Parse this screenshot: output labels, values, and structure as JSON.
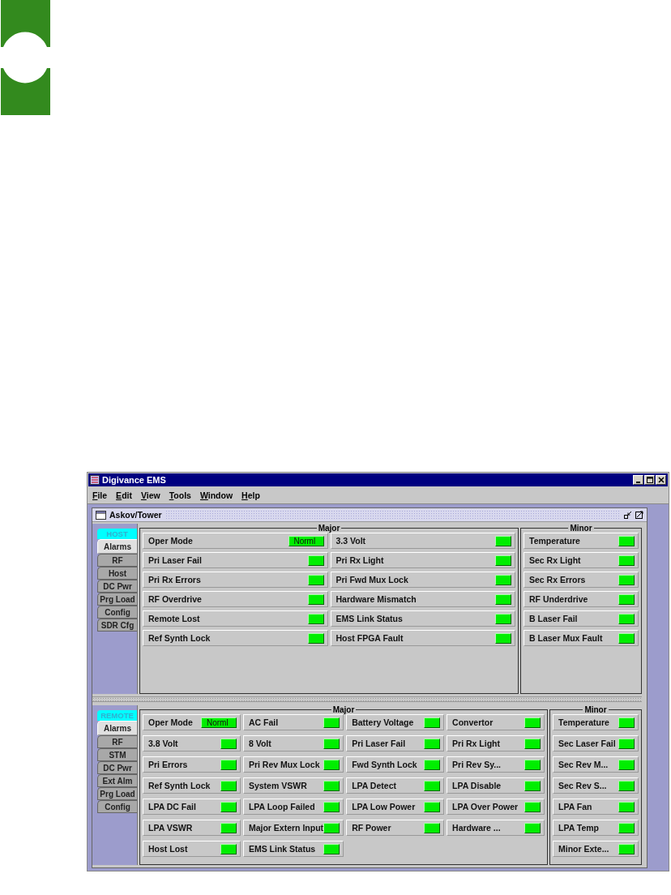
{
  "window": {
    "title": "Digivance EMS"
  },
  "menu": [
    {
      "label": "File"
    },
    {
      "label": "Edit"
    },
    {
      "label": "View"
    },
    {
      "label": "Tools"
    },
    {
      "label": "Window"
    },
    {
      "label": "Help"
    }
  ],
  "frame": {
    "title": "Askov/Tower"
  },
  "panels": [
    {
      "header": "HOST",
      "tabs": [
        {
          "label": "Alarms",
          "selected": true
        },
        {
          "label": "RF",
          "selected": false
        },
        {
          "label": "Host",
          "selected": false
        },
        {
          "label": "DC Pwr",
          "selected": false
        },
        {
          "label": "Prg Load",
          "selected": false
        },
        {
          "label": "Config",
          "selected": false
        },
        {
          "label": "SDR Cfg",
          "selected": false
        }
      ],
      "major": {
        "title": "Major",
        "rows": [
          [
            {
              "label": "Oper Mode",
              "color": "#00ee00",
              "value": "Norml"
            },
            {
              "label": "3.3 Volt",
              "color": "#00ee00"
            }
          ],
          [
            {
              "label": "Pri Laser Fail",
              "color": "#00ee00"
            },
            {
              "label": "Pri Rx Light",
              "color": "#00ee00"
            }
          ],
          [
            {
              "label": "Pri Rx Errors",
              "color": "#00ee00"
            },
            {
              "label": "Pri Fwd Mux Lock",
              "color": "#00ee00"
            }
          ],
          [
            {
              "label": "RF Overdrive",
              "color": "#00ee00"
            },
            {
              "label": "Hardware Mismatch",
              "color": "#00ee00"
            }
          ],
          [
            {
              "label": "Remote Lost",
              "color": "#00ee00"
            },
            {
              "label": "EMS Link Status",
              "color": "#00ee00"
            }
          ],
          [
            {
              "label": "Ref Synth Lock",
              "color": "#00ee00"
            },
            {
              "label": "Host FPGA Fault",
              "color": "#00ee00"
            }
          ]
        ]
      },
      "minor": {
        "title": "Minor",
        "items": [
          {
            "label": "Temperature",
            "color": "#00ee00"
          },
          {
            "label": "Sec Rx Light",
            "color": "#00ee00"
          },
          {
            "label": "Sec Rx Errors",
            "color": "#00ee00"
          },
          {
            "label": "RF Underdrive",
            "color": "#00ee00"
          },
          {
            "label": "B Laser Fail",
            "color": "#00ee00"
          },
          {
            "label": "B Laser Mux Fault",
            "color": "#00ee00"
          }
        ]
      }
    },
    {
      "header": "REMOTE",
      "tabs": [
        {
          "label": "Alarms",
          "selected": true
        },
        {
          "label": "RF",
          "selected": false
        },
        {
          "label": "STM",
          "selected": false
        },
        {
          "label": "DC Pwr",
          "selected": false
        },
        {
          "label": "Ext Alm",
          "selected": false
        },
        {
          "label": "Prg Load",
          "selected": false
        },
        {
          "label": "Config",
          "selected": false
        }
      ],
      "major": {
        "title": "Major",
        "rows": [
          [
            {
              "label": "Oper Mode",
              "color": "#00ee00",
              "value": "Norml"
            },
            {
              "label": "AC Fail",
              "color": "#00ee00"
            },
            {
              "label": "Battery Voltage",
              "color": "#00ee00"
            },
            {
              "label": "Convertor",
              "color": "#00ee00"
            }
          ],
          [
            {
              "label": "3.8 Volt",
              "color": "#00ee00"
            },
            {
              "label": "8 Volt",
              "color": "#00ee00"
            },
            {
              "label": "Pri Laser Fail",
              "color": "#00ee00"
            },
            {
              "label": "Pri Rx Light",
              "color": "#00ee00"
            }
          ],
          [
            {
              "label": "Pri Errors",
              "color": "#00ee00"
            },
            {
              "label": "Pri Rev Mux Lock",
              "color": "#00ee00"
            },
            {
              "label": "Fwd Synth Lock",
              "color": "#00ee00"
            },
            {
              "label": "Pri Rev Sy...",
              "color": "#00ee00"
            }
          ],
          [
            {
              "label": "Ref Synth Lock",
              "color": "#00ee00"
            },
            {
              "label": "System VSWR",
              "color": "#00ee00"
            },
            {
              "label": "LPA Detect",
              "color": "#00ee00"
            },
            {
              "label": "LPA Disable",
              "color": "#00ee00"
            }
          ],
          [
            {
              "label": "LPA DC Fail",
              "color": "#00ee00"
            },
            {
              "label": "LPA Loop Failed",
              "color": "#00ee00"
            },
            {
              "label": "LPA Low Power",
              "color": "#00ee00"
            },
            {
              "label": "LPA Over Power",
              "color": "#00ee00"
            }
          ],
          [
            {
              "label": "LPA VSWR",
              "color": "#00ee00"
            },
            {
              "label": "Major Extern Input",
              "color": "#00ee00"
            },
            {
              "label": "RF Power",
              "color": "#00ee00"
            },
            {
              "label": "Hardware ...",
              "color": "#00ee00"
            }
          ],
          [
            {
              "label": "Host Lost",
              "color": "#00ee00"
            },
            {
              "label": "EMS Link Status",
              "color": "#00ee00"
            }
          ]
        ]
      },
      "minor": {
        "title": "Minor",
        "items": [
          {
            "label": "Temperature",
            "color": "#00ee00"
          },
          {
            "label": "Sec Laser Fail",
            "color": "#00ee00"
          },
          {
            "label": "Sec Rev M...",
            "color": "#00ee00"
          },
          {
            "label": "Sec Rev S...",
            "color": "#00ee00"
          },
          {
            "label": "LPA Fan",
            "color": "#00ee00"
          },
          {
            "label": "LPA Temp",
            "color": "#00ee00"
          },
          {
            "label": "Minor Exte...",
            "color": "#00ee00"
          }
        ]
      }
    }
  ]
}
